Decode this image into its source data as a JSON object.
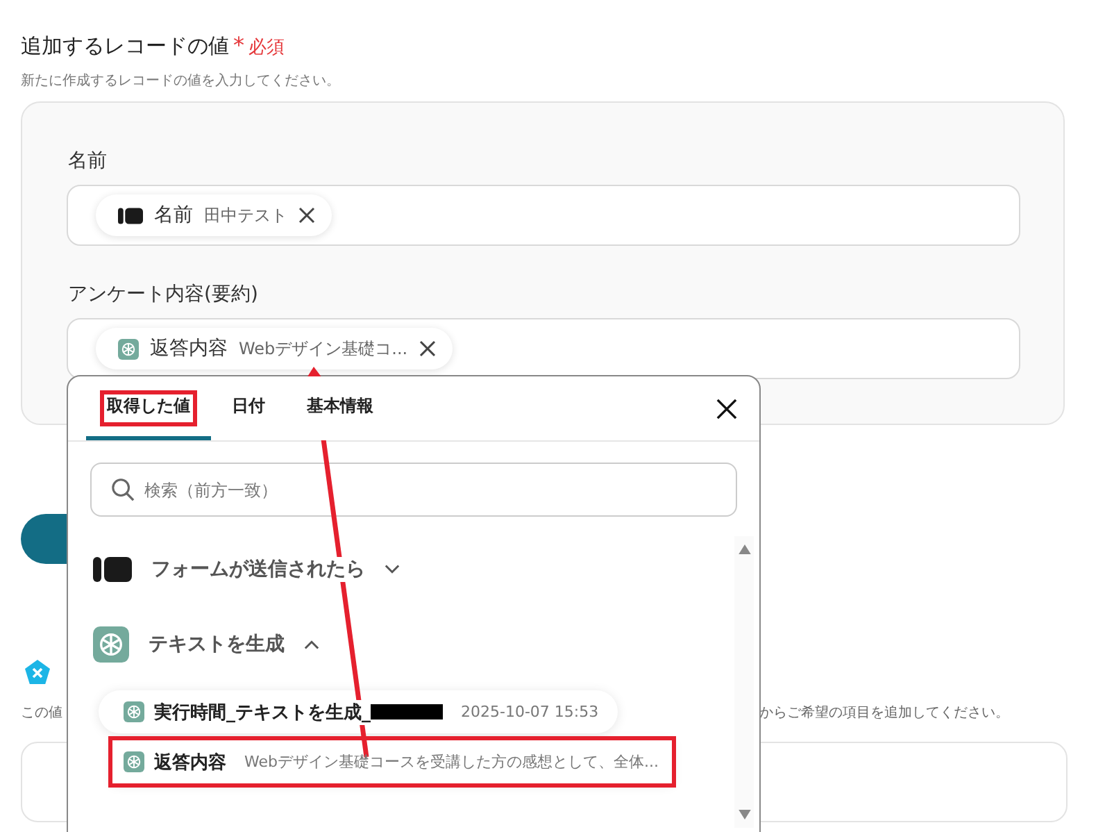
{
  "section": {
    "title": "追加するレコードの値",
    "required_mark": "*",
    "required_label": "必須",
    "description": "新たに作成するレコードの値を入力してください。"
  },
  "fields": [
    {
      "label": "名前",
      "token": {
        "kind": "form",
        "name": "名前",
        "value": "田中テスト"
      }
    },
    {
      "label": "アンケート内容(要約)",
      "token": {
        "kind": "ai",
        "name": "返答内容",
        "value": "Webデザイン基礎コ..."
      }
    }
  ],
  "lower_section": {
    "hint_left": "この値",
    "hint_right": "からご希望の項目を追加してください。"
  },
  "popup": {
    "tabs": [
      {
        "label": "取得した値",
        "selected": true,
        "highlighted": true
      },
      {
        "label": "日付",
        "selected": false,
        "highlighted": false
      },
      {
        "label": "基本情報",
        "selected": false,
        "highlighted": false
      }
    ],
    "search": {
      "placeholder": "検索（前方一致）"
    },
    "groups": [
      {
        "kind": "form",
        "title": "フォームが送信されたら",
        "expanded": false
      },
      {
        "kind": "ai",
        "title": "テキストを生成",
        "expanded": true,
        "items": [
          {
            "name": "実行時間_テキストを生成_",
            "redacted": true,
            "value": "2025-10-07 15:53",
            "highlighted": false
          },
          {
            "name": "返答内容",
            "redacted": false,
            "value": "Webデザイン基礎コースを受講した方の感想として、全体...",
            "highlighted": true
          }
        ]
      }
    ]
  },
  "annotations": [
    {
      "kind": "arrow"
    }
  ]
}
